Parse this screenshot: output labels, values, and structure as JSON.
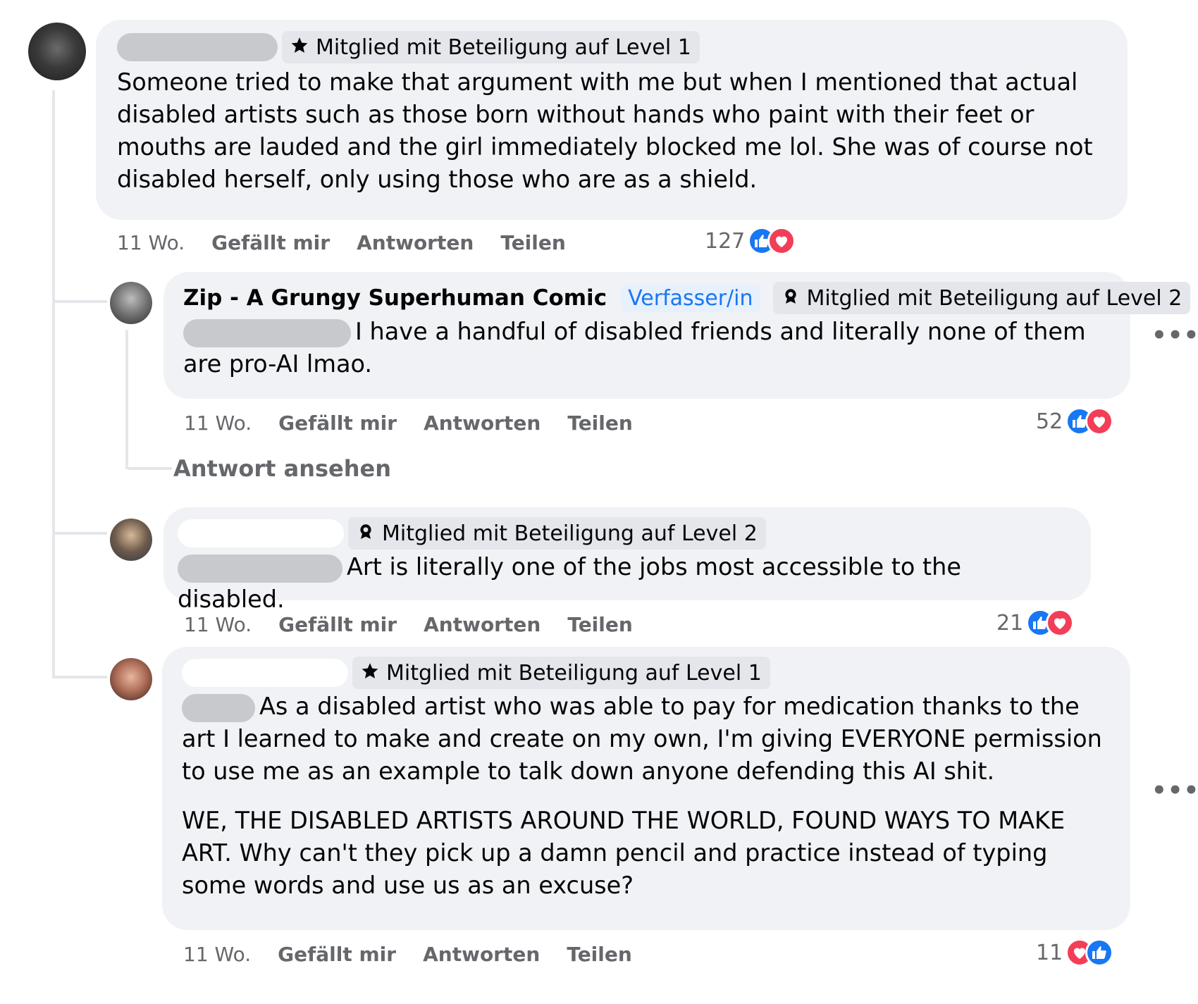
{
  "comments": [
    {
      "badge": "Mitglied mit Beteiligung auf Level 1",
      "badge_icon": "star-icon",
      "text": "Someone tried to make that argument with me but when I mentioned that actual disabled artists such as those born without hands who paint with their feet or mouths are lauded and the girl immediately blocked me lol. She was of course not disabled herself, only using those who are as a shield.",
      "time": "11 Wo.",
      "like_label": "Gefällt mir",
      "reply_label": "Antworten",
      "share_label": "Teilen",
      "reaction_count": "127",
      "reaction_icons": [
        "like-icon",
        "love-icon"
      ]
    },
    {
      "author": "Zip - A Grungy Superhuman Comic",
      "author_tag": "Verfasser/in",
      "badge": "Mitglied mit Beteiligung auf Level 2",
      "badge_icon": "rosette-icon",
      "text": "I have a handful of disabled friends and literally none of them are pro-AI lmao.",
      "time": "11 Wo.",
      "like_label": "Gefällt mir",
      "reply_label": "Antworten",
      "share_label": "Teilen",
      "reaction_count": "52",
      "reaction_icons": [
        "like-icon",
        "love-icon"
      ],
      "view_replies": "Antwort ansehen"
    },
    {
      "badge": "Mitglied mit Beteiligung auf Level 2",
      "badge_icon": "rosette-icon",
      "text": "Art is literally one of the jobs most accessible to the disabled.",
      "time": "11 Wo.",
      "like_label": "Gefällt mir",
      "reply_label": "Antworten",
      "share_label": "Teilen",
      "reaction_count": "21",
      "reaction_icons": [
        "like-icon",
        "love-icon"
      ]
    },
    {
      "badge": "Mitglied mit Beteiligung auf Level 1",
      "badge_icon": "star-icon",
      "text_p1": "As a disabled artist who was able to pay for medication thanks to the art I learned to make and create on my own, I'm giving EVERYONE permission to use me as an example to talk down anyone defending this AI shit.",
      "text_p2": "WE, THE DISABLED ARTISTS AROUND THE WORLD, FOUND WAYS TO MAKE ART. Why can't they pick up a damn pencil and practice instead of typing some words and use us as an excuse?",
      "time": "11 Wo.",
      "like_label": "Gefällt mir",
      "reply_label": "Antworten",
      "share_label": "Teilen",
      "reaction_count": "11",
      "reaction_icons": [
        "love-icon",
        "like-icon"
      ]
    }
  ],
  "more_icon": "•••",
  "colors": {
    "bubble": "#f0f2f5",
    "secondary_text": "#65676b",
    "like": "#1877f2",
    "love": "#f33e58",
    "author_tag": "#1877f2",
    "badge_bg": "#e4e6eb"
  }
}
